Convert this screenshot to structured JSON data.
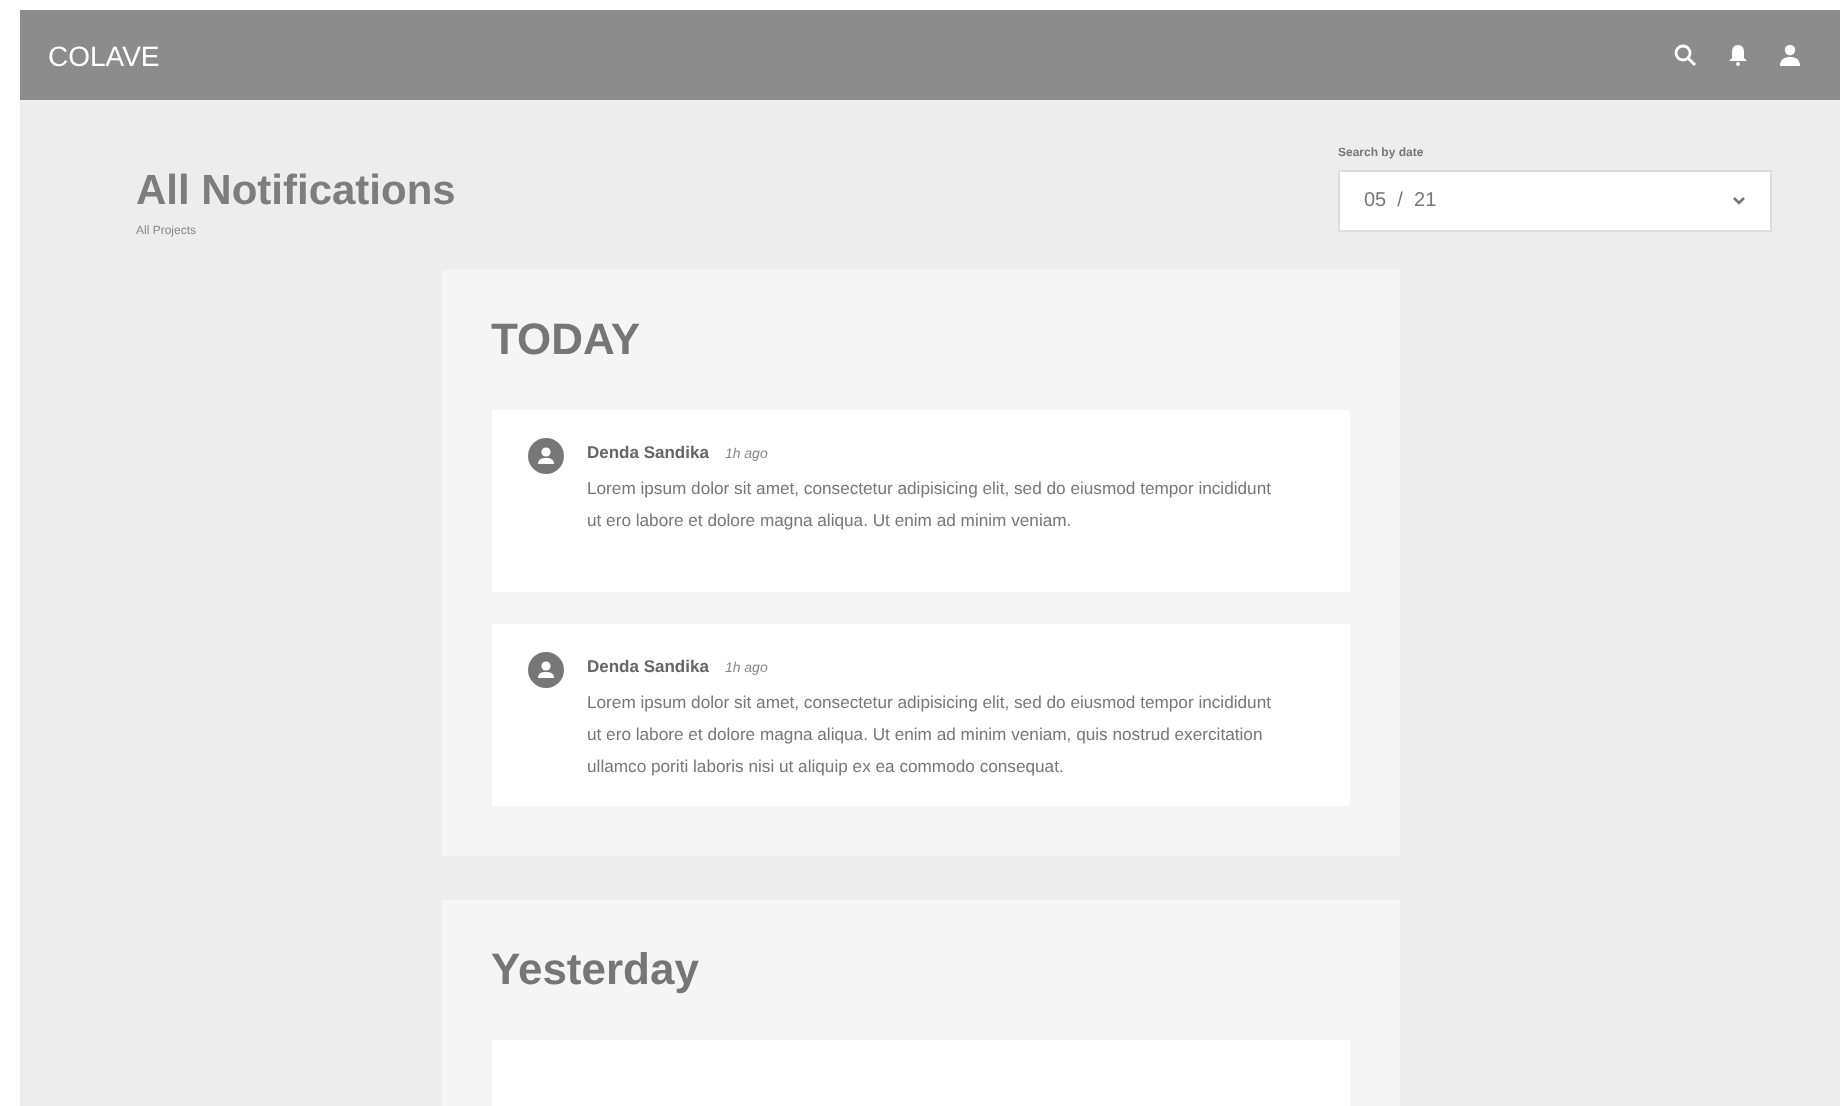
{
  "header": {
    "brand": "COLAVE"
  },
  "page": {
    "title": "All Notifications",
    "subtitle": "All Projects"
  },
  "date_filter": {
    "label": "Search by date",
    "value": "05  /  21"
  },
  "sections": [
    {
      "title": "TODAY",
      "notifications": [
        {
          "author": "Denda Sandika",
          "time": "1h ago",
          "text": "Lorem ipsum dolor sit amet, consectetur adipisicing elit, sed do eiusmod tempor incididunt ut ero labore et dolore magna aliqua. Ut enim ad minim veniam."
        },
        {
          "author": "Denda Sandika",
          "time": "1h ago",
          "text": "Lorem ipsum dolor sit amet, consectetur adipisicing elit, sed do eiusmod tempor incididunt ut ero labore et dolore magna aliqua. Ut enim ad minim veniam, quis nostrud exercitation ullamco poriti laboris nisi ut aliquip ex ea commodo consequat."
        }
      ]
    },
    {
      "title": "Yesterday"
    }
  ]
}
